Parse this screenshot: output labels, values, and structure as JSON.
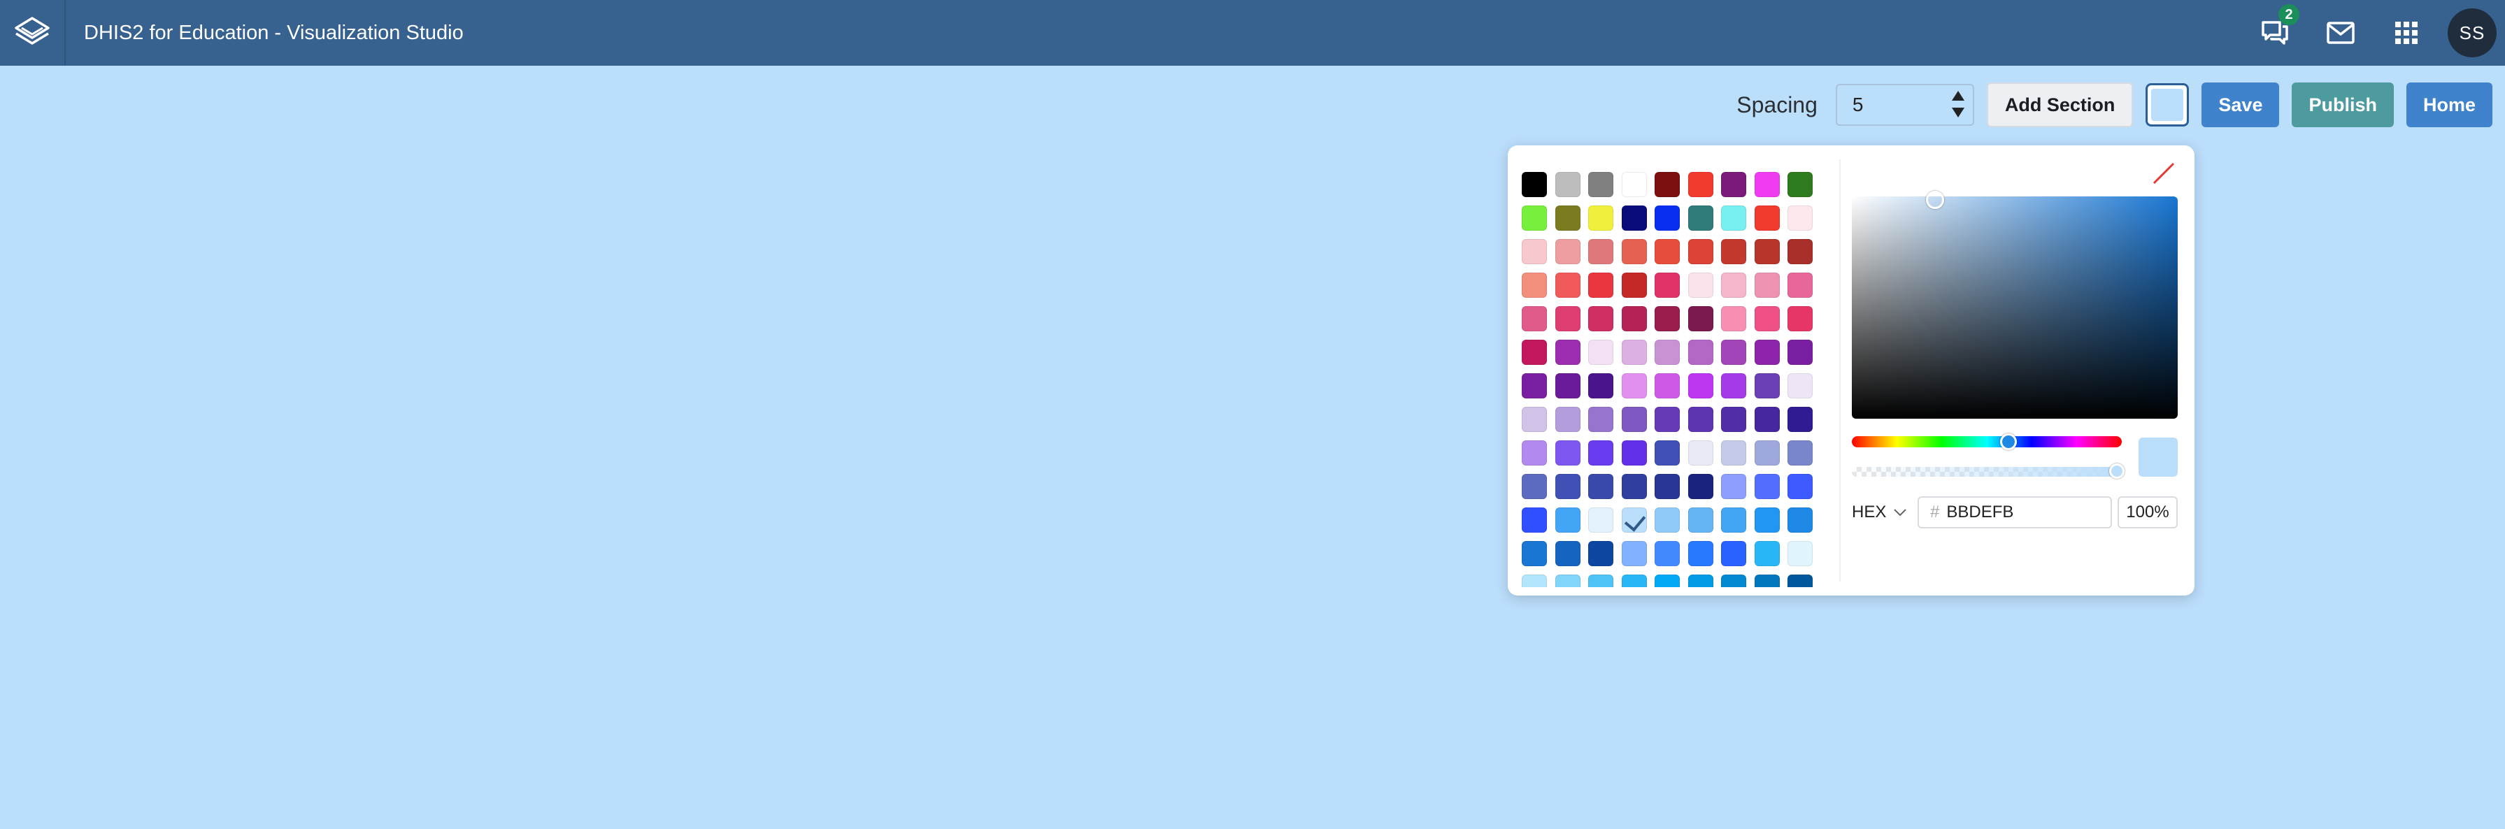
{
  "header": {
    "title": "DHIS2 for Education - Visualization Studio",
    "messages_badge": "2",
    "avatar_initials": "SS"
  },
  "toolbar": {
    "spacing_label": "Spacing",
    "spacing_value": "5",
    "add_section_label": "Add Section",
    "save_label": "Save",
    "publish_label": "Publish",
    "home_label": "Home"
  },
  "picker": {
    "format_label": "HEX",
    "hash": "#",
    "hex_value": "BBDEFB",
    "alpha_value": "100%",
    "selected_color": "#BBDEFB",
    "palette": [
      "#000000",
      "#BDBDBD",
      "#808080",
      "#FFFFFF",
      "#7B1010",
      "#F03A2E",
      "#7B1A7A",
      "#F03CF0",
      "#2E7B1F",
      "#76F03C",
      "#7B7B1F",
      "#F0F03C",
      "#0A0A7B",
      "#0A2EF0",
      "#2E7B7B",
      "#76F0F0",
      "#F03A2E",
      "#FDE8EC",
      "#F8C8CF",
      "#EE9E9E",
      "#E07A7A",
      "#E66151",
      "#E84C3D",
      "#DC4236",
      "#C3392E",
      "#B8352C",
      "#A82E2A",
      "#F28E7C",
      "#F05A5A",
      "#E9363F",
      "#C62828",
      "#E03368",
      "#FBE3EC",
      "#F5B5CB",
      "#EE92B1",
      "#E8679A",
      "#E05A8C",
      "#DE3D70",
      "#CE2E60",
      "#B52356",
      "#9A1D4E",
      "#7A1A4C",
      "#F78FB3",
      "#EE4F85",
      "#E53666",
      "#C2185B",
      "#9C2DB0",
      "#F3E0F5",
      "#DDB0E3",
      "#C892D4",
      "#B367C6",
      "#A245B8",
      "#8E24AA",
      "#7B1FA2",
      "#7A1FA2",
      "#6A1B9A",
      "#4A148C",
      "#E290F0",
      "#D05AE8",
      "#BD37F0",
      "#A43BE8",
      "#6A3FB5",
      "#EEE6F7",
      "#D1C2E8",
      "#B39DDB",
      "#9575CD",
      "#7E57C2",
      "#673AB7",
      "#5E35B1",
      "#512DA8",
      "#4527A0",
      "#311B92",
      "#B389F0",
      "#7E57F0",
      "#6A3CF0",
      "#6230E8",
      "#3F51B5",
      "#E8EAF6",
      "#C5CAE9",
      "#9FA8DA",
      "#7986CB",
      "#5C6BC0",
      "#3F51B5",
      "#3949AB",
      "#303F9F",
      "#283593",
      "#1A237E",
      "#8C9EFF",
      "#536DFE",
      "#3D5AFE",
      "#304FFE",
      "#42A5F5",
      "#E3F2FD",
      "#BBDEFB",
      "#90CAF9",
      "#64B5F6",
      "#42A5F5",
      "#2196F3",
      "#1E88E5",
      "#1976D2",
      "#1565C0",
      "#0D47A1",
      "#82B1FF",
      "#448AFF",
      "#2979FF",
      "#2962FF",
      "#29B6F6",
      "#E1F5FE",
      "#B3E5FC",
      "#81D4FA",
      "#4FC3F7",
      "#29B6F6",
      "#03A9F4",
      "#039BE5",
      "#0288D1",
      "#0277BD",
      "#01579B"
    ]
  }
}
